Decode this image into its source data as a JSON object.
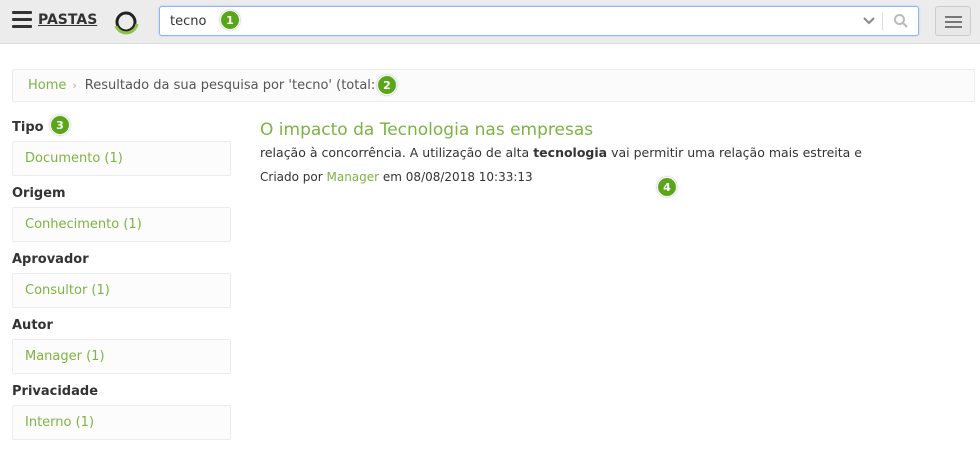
{
  "header": {
    "brand": "PASTAS",
    "search": {
      "value": "tecno",
      "placeholder": ""
    }
  },
  "breadcrumb": {
    "home": "Home",
    "current": "Resultado da sua pesquisa por 'tecno' (total: 1)"
  },
  "facets": [
    {
      "title": "Tipo",
      "items": [
        "Documento (1)"
      ]
    },
    {
      "title": "Origem",
      "items": [
        "Conhecimento (1)"
      ]
    },
    {
      "title": "Aprovador",
      "items": [
        "Consultor (1)"
      ]
    },
    {
      "title": "Autor",
      "items": [
        "Manager (1)"
      ]
    },
    {
      "title": "Privacidade",
      "items": [
        "Interno (1)"
      ]
    }
  ],
  "results": [
    {
      "title": "O impacto da Tecnologia nas empresas",
      "snippet_before": "relação à concorrência. A utilização de alta ",
      "snippet_highlight": "tecnologia",
      "snippet_after": " vai permitir uma relação mais estreita e",
      "meta_prefix": "Criado por ",
      "author": "Manager",
      "meta_suffix": " em 08/08/2018 10:33:13"
    }
  ],
  "badges": [
    "1",
    "2",
    "3",
    "4"
  ],
  "colors": {
    "accent": "#7cb342",
    "badge": "#5aa61a"
  }
}
